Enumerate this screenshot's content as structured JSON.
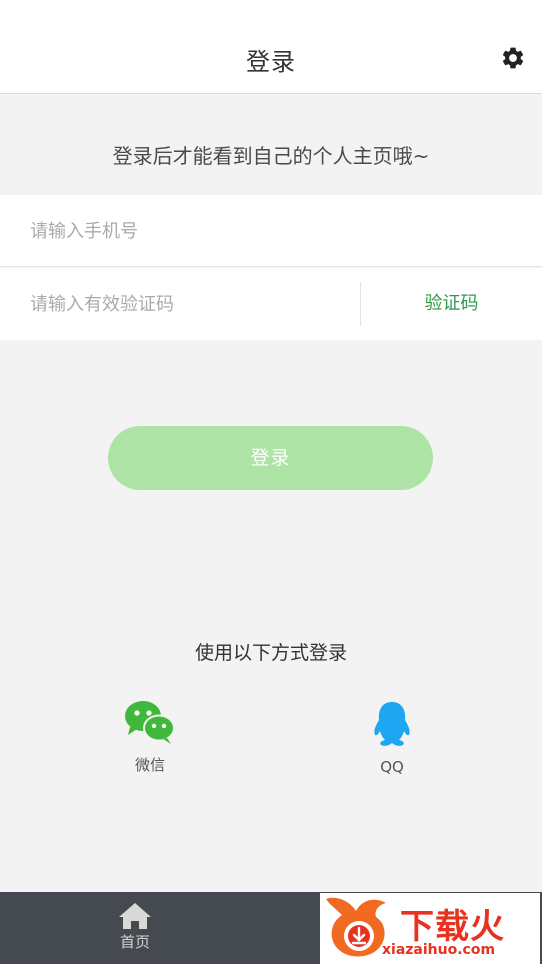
{
  "header": {
    "title": "登录",
    "settings_icon": "gear-icon"
  },
  "tip": "登录后才能看到自己的个人主页哦~",
  "form": {
    "phone_placeholder": "请输入手机号",
    "phone_value": "",
    "code_placeholder": "请输入有效验证码",
    "code_value": "",
    "code_button": "验证码"
  },
  "login_button": "登录",
  "alternative": {
    "title": "使用以下方式登录",
    "options": [
      {
        "label": "微信",
        "icon": "wechat-icon",
        "color": "#3fb83b"
      },
      {
        "label": "QQ",
        "icon": "qq-icon",
        "color": "#1ea6f2"
      }
    ]
  },
  "bottom_nav": {
    "tabs": [
      {
        "label": "首页",
        "icon": "home-icon"
      }
    ]
  },
  "watermark": {
    "brand": "下载火",
    "site": "xiazaihuo.com",
    "icon": "flame-logo-icon"
  },
  "colors": {
    "accent_green": "#2e9a4a",
    "login_button_bg": "#ade4a6",
    "bottom_bar_bg": "#454a50",
    "page_bg": "#f3f3f3"
  }
}
